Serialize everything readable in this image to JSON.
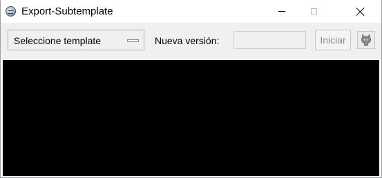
{
  "window": {
    "title": "Export-Subtemplate"
  },
  "toolbar": {
    "template_select_value": "Seleccione template",
    "version_label": "Nueva versión:",
    "version_value": "",
    "start_label": "Iniciar",
    "github_icon": "github-octocat-icon"
  },
  "console": {
    "background": "#000000",
    "text": ""
  },
  "colors": {
    "toolbar_bg": "#f0f0f0",
    "disabled_text": "#8a8a8a"
  }
}
